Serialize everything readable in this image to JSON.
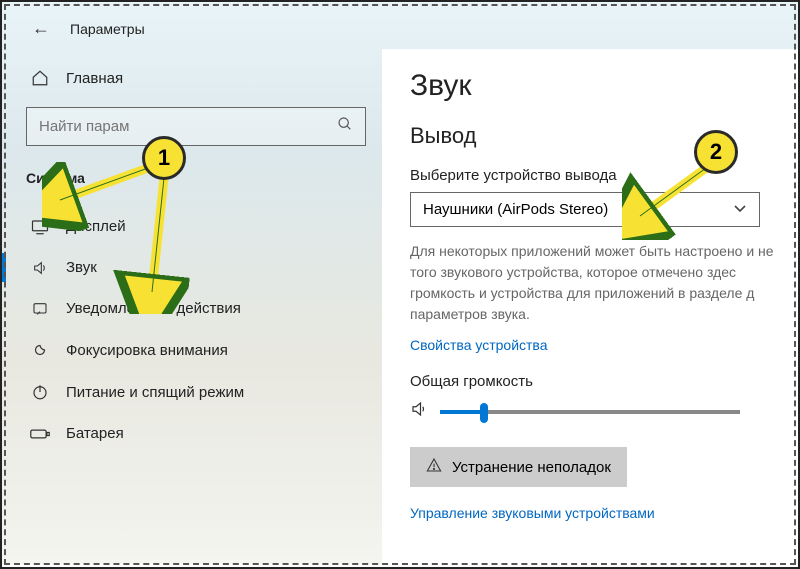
{
  "header": {
    "title": "Параметры"
  },
  "sidebar": {
    "home": "Главная",
    "search_placeholder": "Найти парам",
    "group": "Система",
    "items": [
      {
        "icon": "display-icon",
        "label": "Дисплей"
      },
      {
        "icon": "sound-icon",
        "label": "Звук"
      },
      {
        "icon": "notifications-icon",
        "label": "Уведомления и действия"
      },
      {
        "icon": "focus-icon",
        "label": "Фокусировка внимания"
      },
      {
        "icon": "power-icon",
        "label": "Питание и спящий режим"
      },
      {
        "icon": "battery-icon",
        "label": "Батарея"
      }
    ]
  },
  "main": {
    "title": "Звук",
    "output": {
      "heading": "Вывод",
      "choose_label": "Выберите устройство вывода",
      "selected": "Наушники (AirPods Stereo)",
      "help": "Для некоторых приложений может быть настроено и не того звукового устройства, которое отмечено здес громкость и устройства для приложений в разделе д параметров звука.",
      "props_link": "Свойства устройства",
      "volume_label": "Общая громкость",
      "troubleshoot": "Устранение неполадок",
      "manage_link": "Управление звуковыми устройствами"
    }
  },
  "annotations": {
    "m1": "1",
    "m2": "2"
  }
}
